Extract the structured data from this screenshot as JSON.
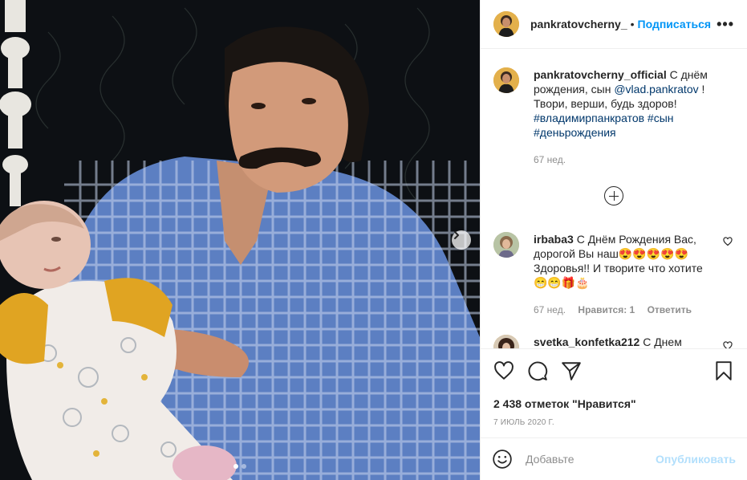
{
  "post": {
    "author": "pankratovcherny_",
    "header_separator": "•",
    "follow_label": "Подписаться",
    "more_label": "•••"
  },
  "caption": {
    "author": "pankratovcherny_official",
    "text_1": " С днём рождения, сын ",
    "mention": "@vlad.pankratov",
    "text_2": " ! Твори, верши, будь здоров! ",
    "hashtags": "#владимирпанкратов #сын #деньрождения",
    "time": "67 нед."
  },
  "comments": [
    {
      "author": "irbaba3",
      "text": " С Днём Рождения Вас, дорогой Вы наш😍😍😍😍😍 Здоровья!! И творите что хотите 😁😁🎁🎂",
      "time": "67 нед.",
      "likes": "Нравится: 1",
      "reply": "Ответить"
    },
    {
      "author": "svetka_konfetka212",
      "text": " С Днем",
      "time": "",
      "likes": "",
      "reply": ""
    }
  ],
  "stats": {
    "likes": "2 438 отметок \"Нравится\"",
    "date": "7 ИЮЛЬ 2020 Г."
  },
  "compose": {
    "placeholder": "Добавьте",
    "publish_label": "Опубликовать"
  },
  "carousel": {
    "slides": 2,
    "active": 1
  },
  "icons": {
    "like": "heart-icon",
    "comment": "comment-icon",
    "share": "paper-plane-icon",
    "save": "bookmark-icon",
    "emoji": "smile-icon",
    "next": "chevron-right-icon"
  },
  "colors": {
    "accent": "#0095f6",
    "publish_disabled": "#b2dffc",
    "meta": "#8e8e8e",
    "link": "#00376b"
  }
}
